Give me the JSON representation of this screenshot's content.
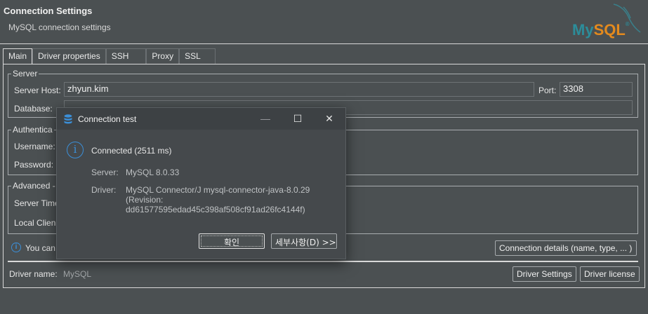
{
  "header": {
    "title": "Connection Settings",
    "subtitle": "MySQL connection settings",
    "logo_text_a": "My",
    "logo_text_b": "SQL"
  },
  "tabs": [
    {
      "label": "Main"
    },
    {
      "label": "Driver properties"
    },
    {
      "label": "SSH"
    },
    {
      "label": "Proxy"
    },
    {
      "label": "SSL"
    }
  ],
  "server": {
    "legend": "Server",
    "host_label": "Server Host:",
    "host_value": "zhyun.kim",
    "port_label": "Port:",
    "port_value": "3308",
    "database_label": "Database:",
    "database_value": ""
  },
  "auth": {
    "legend": "Authentica",
    "username_label": "Username:",
    "password_label": "Password:"
  },
  "advanced": {
    "legend": "Advanced -",
    "server_time_label": "Server Time",
    "local_client_label": "Local Clien"
  },
  "info_line": {
    "text": "You can"
  },
  "buttons": {
    "connection_details": "Connection details (name, type, ... )",
    "driver_settings": "Driver Settings",
    "driver_license": "Driver license"
  },
  "driver": {
    "label": "Driver name:",
    "value": "MySQL"
  },
  "dialog": {
    "title": "Connection test",
    "minimize": "—",
    "maximize": "☐",
    "close": "✕",
    "message": "Connected (2511 ms)",
    "server_label": "Server:",
    "server_value": "MySQL 8.0.33",
    "driver_label": "Driver:",
    "driver_line1": "MySQL Connector/J mysql-connector-java-8.0.29",
    "driver_line2": "(Revision:",
    "driver_line3": "dd61577595edad45c398af508cf91ad26fc4144f)",
    "ok_label": "확인",
    "details_label": "세부사항(D) >>"
  },
  "colors": {
    "background": "#4b5052",
    "accent_info": "#3b8fd8",
    "logo_teal": "#2c8d9a",
    "logo_orange": "#e48a1d"
  }
}
